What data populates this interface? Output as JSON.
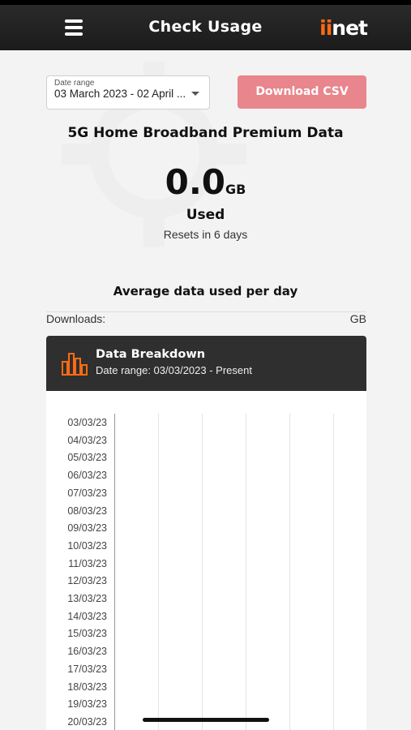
{
  "header": {
    "title": "Check Usage",
    "logo_prefix": "ii",
    "logo_suffix": "net"
  },
  "filters": {
    "date_range_label": "Date range",
    "date_range_value": "03 March 2023 - 02 April ...",
    "download_label": "Download CSV"
  },
  "plan": {
    "name": "5G Home Broadband Premium Data"
  },
  "usage": {
    "value": "0.0",
    "unit": "GB",
    "used_label": "Used",
    "resets_text": "Resets in 6 days"
  },
  "average": {
    "title": "Average data used per day",
    "downloads_label": "Downloads:",
    "downloads_value": "GB"
  },
  "breakdown": {
    "title": "Data Breakdown",
    "subtitle": "Date range: 03/03/2023 - Present"
  },
  "chart_data": {
    "type": "bar",
    "orientation": "horizontal",
    "categories": [
      "03/03/23",
      "04/03/23",
      "05/03/23",
      "06/03/23",
      "07/03/23",
      "08/03/23",
      "09/03/23",
      "10/03/23",
      "11/03/23",
      "12/03/23",
      "13/03/23",
      "14/03/23",
      "15/03/23",
      "16/03/23",
      "17/03/23",
      "18/03/23",
      "19/03/23",
      "20/03/23"
    ],
    "values": [
      0,
      0,
      0,
      0,
      0,
      0,
      0,
      0,
      0,
      0,
      0,
      0,
      0,
      0,
      0,
      0,
      0,
      0
    ],
    "grid": true
  },
  "colors": {
    "accent": "#ff6a13",
    "button": "#e9858c",
    "header_bg": "#1b1b1b",
    "panel_bg": "#2f2f2f"
  }
}
